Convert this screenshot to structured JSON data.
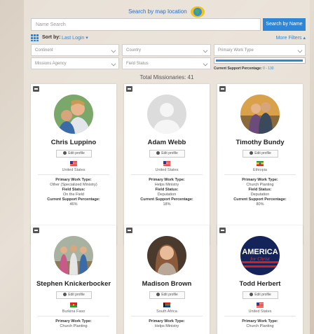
{
  "search": {
    "map_link": "Search by map location",
    "name_placeholder": "Name Search",
    "search_button": "Search by Name"
  },
  "sort": {
    "label": "Sort by:",
    "value": "Last Login",
    "more_filters": "More Filters"
  },
  "filters": {
    "continent": "Continent",
    "country": "Country",
    "primary_work_type": "Primary Work Type",
    "missions_agency": "Missions Agency",
    "field_status": "Field Status"
  },
  "support_filter": {
    "label": "Current Support Percentage:",
    "range": "0 - 130",
    "fill_fraction": 0.98
  },
  "total": "Total Missionaries: 41",
  "labels": {
    "edit_profile": "Edit profile",
    "primary_work_type": "Primary Work Type:",
    "field_status": "Field Status:",
    "current_support": "Current Support Percentage:"
  },
  "cards": [
    {
      "name": "Chris Luppino",
      "country": "United States",
      "work_type": "Other (Specialized Ministry)",
      "field_status": "On the Field",
      "support": "46%"
    },
    {
      "name": "Adam Webb",
      "country": "United States",
      "work_type": "Helps Ministry",
      "field_status": "Deputation",
      "support": "18%"
    },
    {
      "name": "Timothy Bundy",
      "country": "Ethiopia",
      "work_type": "Church Planting",
      "field_status": "Deputation",
      "support": "80%"
    },
    {
      "name": "Stephen Knickerbocker",
      "country": "Burkina Faso",
      "work_type": "Church Planting",
      "field_status": "",
      "support": ""
    },
    {
      "name": "Madison Brown",
      "country": "South Africa",
      "work_type": "Helps Ministry",
      "field_status": "",
      "support": ""
    },
    {
      "name": "Todd Herbert",
      "country": "United States",
      "work_type": "Church Planting",
      "field_status": "",
      "support": ""
    }
  ],
  "logo_text": {
    "line1": "AMERICA",
    "line2": "for Christ"
  },
  "colors": {
    "accent": "#2e86d6"
  }
}
